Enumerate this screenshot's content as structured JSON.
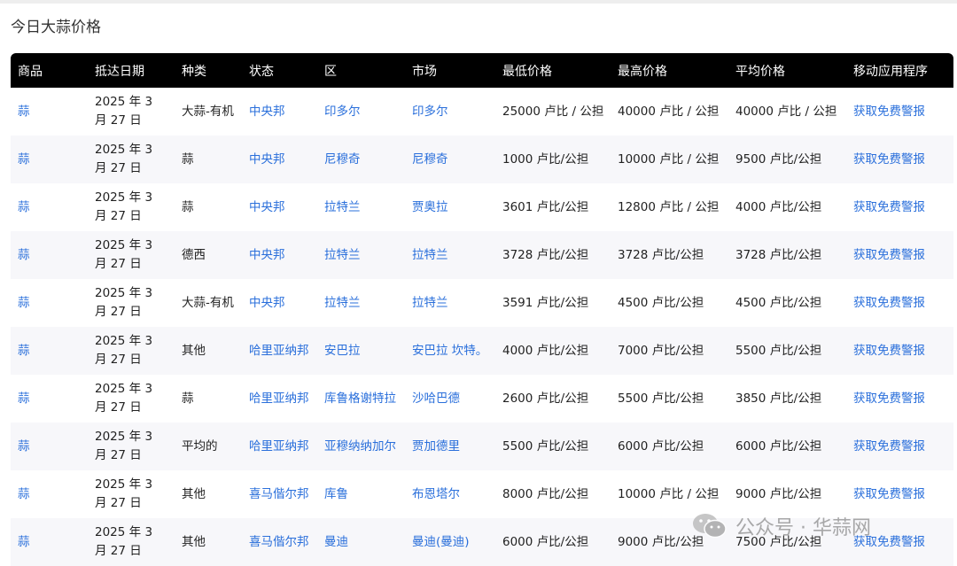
{
  "page": {
    "title": "今日大蒜价格"
  },
  "table": {
    "headers": [
      "商品",
      "抵达日期",
      "种类",
      "状态",
      "区",
      "市场",
      "最低价格",
      "最高价格",
      "平均价格",
      "移动应用程序"
    ],
    "rows": [
      {
        "commodity": "蒜",
        "date": "2025 年 3 月 27 日",
        "variety": "大蒜-有机",
        "state": "中央邦",
        "district": "印多尔",
        "market": "印多尔",
        "min": "25000 卢比 / 公担",
        "max": "40000 卢比 / 公担",
        "avg": "40000 卢比 / 公担",
        "app": "获取免费警报"
      },
      {
        "commodity": "蒜",
        "date": "2025 年 3 月 27 日",
        "variety": "蒜",
        "state": "中央邦",
        "district": "尼穆奇",
        "market": "尼穆奇",
        "min": "1000 卢比/公担",
        "max": "10000 卢比 / 公担",
        "avg": "9500 卢比/公担",
        "app": "获取免费警报"
      },
      {
        "commodity": "蒜",
        "date": "2025 年 3 月 27 日",
        "variety": "蒜",
        "state": "中央邦",
        "district": "拉特兰",
        "market": "贾奥拉",
        "min": "3601 卢比/公担",
        "max": "12800 卢比 / 公担",
        "avg": "4000 卢比/公担",
        "app": "获取免费警报"
      },
      {
        "commodity": "蒜",
        "date": "2025 年 3 月 27 日",
        "variety": "德西",
        "state": "中央邦",
        "district": "拉特兰",
        "market": "拉特兰",
        "min": "3728 卢比/公担",
        "max": "3728 卢比/公担",
        "avg": "3728 卢比/公担",
        "app": "获取免费警报"
      },
      {
        "commodity": "蒜",
        "date": "2025 年 3 月 27 日",
        "variety": "大蒜-有机",
        "state": "中央邦",
        "district": "拉特兰",
        "market": "拉特兰",
        "min": "3591 卢比/公担",
        "max": "4500 卢比/公担",
        "avg": "4500 卢比/公担",
        "app": "获取免费警报"
      },
      {
        "commodity": "蒜",
        "date": "2025 年 3 月 27 日",
        "variety": "其他",
        "state": "哈里亚纳邦",
        "district": "安巴拉",
        "market": "安巴拉 坎特。",
        "min": "4000 卢比/公担",
        "max": "7000 卢比/公担",
        "avg": "5500 卢比/公担",
        "app": "获取免费警报"
      },
      {
        "commodity": "蒜",
        "date": "2025 年 3 月 27 日",
        "variety": "蒜",
        "state": "哈里亚纳邦",
        "district": "库鲁格谢特拉",
        "market": "沙哈巴德",
        "min": "2600 卢比/公担",
        "max": "5500 卢比/公担",
        "avg": "3850 卢比/公担",
        "app": "获取免费警报"
      },
      {
        "commodity": "蒜",
        "date": "2025 年 3 月 27 日",
        "variety": "平均的",
        "state": "哈里亚纳邦",
        "district": "亚穆纳纳加尔",
        "market": "贾加德里",
        "min": "5500 卢比/公担",
        "max": "6000 卢比/公担",
        "avg": "6000 卢比/公担",
        "app": "获取免费警报"
      },
      {
        "commodity": "蒜",
        "date": "2025 年 3 月 27 日",
        "variety": "其他",
        "state": "喜马偕尔邦",
        "district": "库鲁",
        "market": "布恩塔尔",
        "min": "8000 卢比/公担",
        "max": "10000 卢比 / 公担",
        "avg": "9000 卢比/公担",
        "app": "获取免费警报"
      },
      {
        "commodity": "蒜",
        "date": "2025 年 3 月 27 日",
        "variety": "其他",
        "state": "喜马偕尔邦",
        "district": "曼迪",
        "market": "曼迪(曼迪)",
        "min": "6000 卢比/公担",
        "max": "9000 卢比/公担",
        "avg": "7500 卢比/公担",
        "app": "获取免费警报"
      }
    ]
  },
  "watermark": {
    "text": "公众号 · 华蒜网",
    "icon": "wechat-icon"
  },
  "colors": {
    "header_bg": "#000000",
    "link": "#2a6fdb",
    "row_alt": "#f7f7fa"
  }
}
